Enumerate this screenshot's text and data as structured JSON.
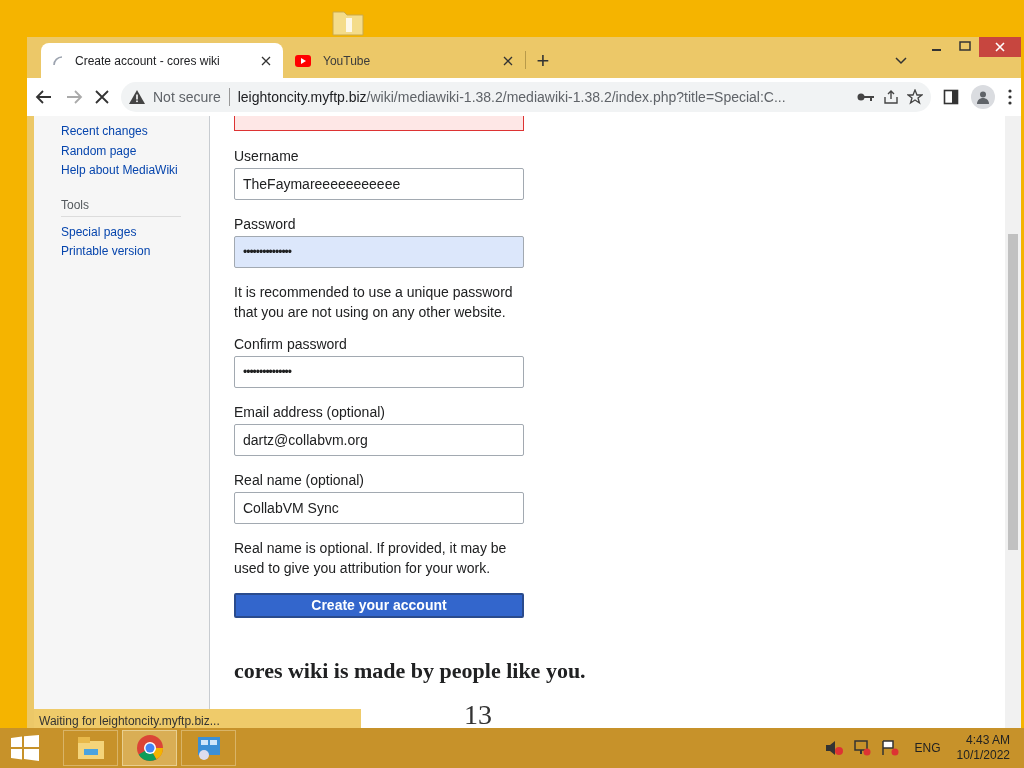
{
  "tabs": [
    {
      "title": "Create account - cores wiki",
      "kind": "loading",
      "selected": true
    },
    {
      "title": "YouTube",
      "kind": "youtube",
      "selected": false
    }
  ],
  "new_tab": "+",
  "address_bar": {
    "security": "Not secure",
    "host": "leightoncity.myftp.biz",
    "path": "/wiki/mediawiki-1.38.2/mediawiki-1.38.2/index.php?title=Special:C..."
  },
  "sidebar": {
    "links": [
      "Recent changes",
      "Random page",
      "Help about MediaWiki"
    ],
    "tools_heading": "Tools",
    "tools": [
      "Special pages",
      "Printable version"
    ]
  },
  "form": {
    "fields": [
      {
        "label": "Username",
        "value": "TheFaymareeeeeeeeeee",
        "kind": "text",
        "focused": false
      },
      {
        "label": "Password",
        "value": "•••••••••••••••",
        "kind": "password",
        "focused": true
      },
      {
        "label": "Confirm password",
        "value": "•••••••••••••••",
        "kind": "password",
        "focused": false,
        "help_before": "It is recommended to use a unique password that you are not using on any other website."
      },
      {
        "label": "Email address (optional)",
        "value": "dartz@collabvm.org",
        "kind": "text",
        "focused": false
      },
      {
        "label": "Real name (optional)",
        "value": "CollabVM Sync",
        "kind": "text",
        "focused": false
      }
    ],
    "note": "Real name is optional. If provided, it may be used to give you attribution for your work.",
    "submit": "Create your account"
  },
  "heading": "cores wiki is made by people like you.",
  "counter": "13",
  "status": "Waiting for leightoncity.myftp.biz...",
  "taskbar": {
    "language": "ENG",
    "time": "4:43 AM",
    "date": "10/1/2022"
  }
}
